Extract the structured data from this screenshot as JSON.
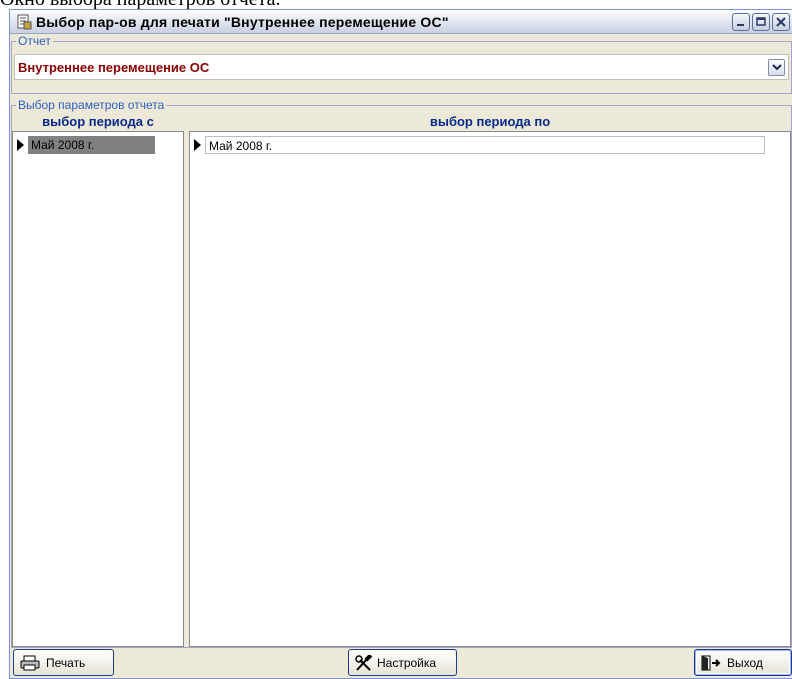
{
  "caption": "Окно выбора параметров отчета.",
  "window": {
    "title": "Выбор пар-ов для печати \"Внутреннее перемещение ОС\""
  },
  "report_group": {
    "legend": "Отчет",
    "selected": "Внутреннее перемещение ОС"
  },
  "params_group": {
    "legend": "Выбор параметров отчета",
    "period_from": {
      "header": "выбор периода с",
      "value": "Май 2008 г."
    },
    "period_to": {
      "header": "выбор  периода по",
      "value": "Май 2008 г."
    }
  },
  "buttons": {
    "print": "Печать",
    "settings": "Настройка",
    "exit": "Выход"
  },
  "icons": [
    "app-icon",
    "minimize-icon",
    "maximize-icon",
    "close-icon",
    "chevron-down-icon",
    "row-marker-icon",
    "printer-icon",
    "tools-icon",
    "exit-door-icon"
  ]
}
